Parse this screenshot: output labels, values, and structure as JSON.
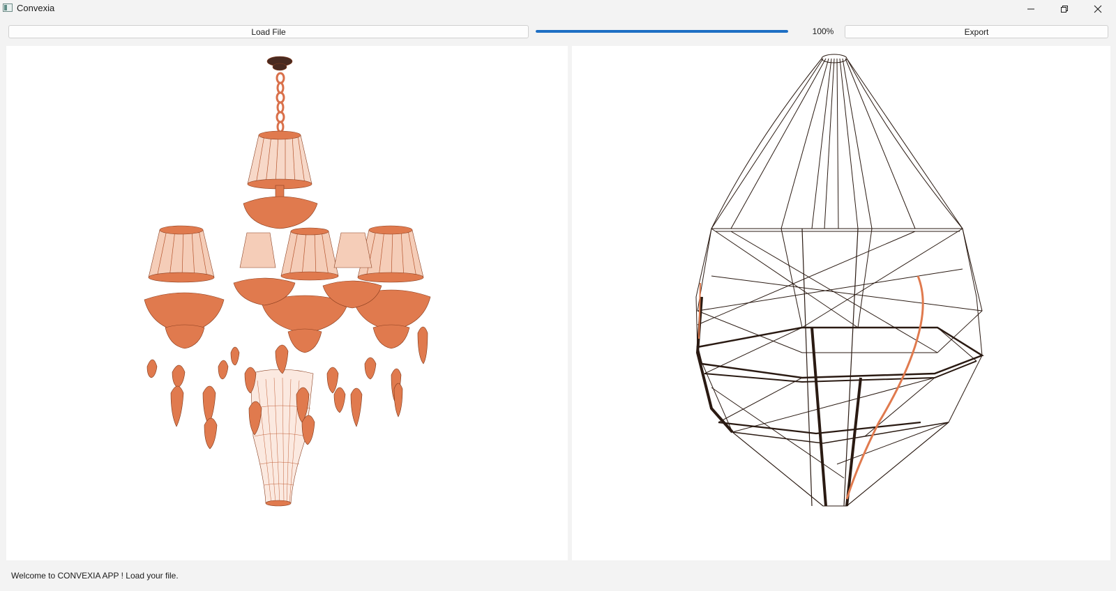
{
  "window": {
    "title": "Convexia",
    "app_icon": "app-window-icon",
    "controls": [
      "minimize-icon",
      "restore-icon",
      "close-icon"
    ]
  },
  "toolbar": {
    "load_label": "Load File",
    "export_label": "Export",
    "progress": {
      "value": 1.0,
      "label": "100%"
    }
  },
  "viewports": {
    "left": {
      "content": "chandelier-model",
      "color": "#e07a4e"
    },
    "right": {
      "content": "convex-hull-wireframe",
      "color": "#2a1a12"
    }
  },
  "status": {
    "message": "Welcome to CONVEXIA APP ! Load your file."
  },
  "colors": {
    "accent": "#1e6fc4",
    "model": "#e07a4e",
    "wire": "#2a1a12",
    "background": "#f3f3f3"
  }
}
